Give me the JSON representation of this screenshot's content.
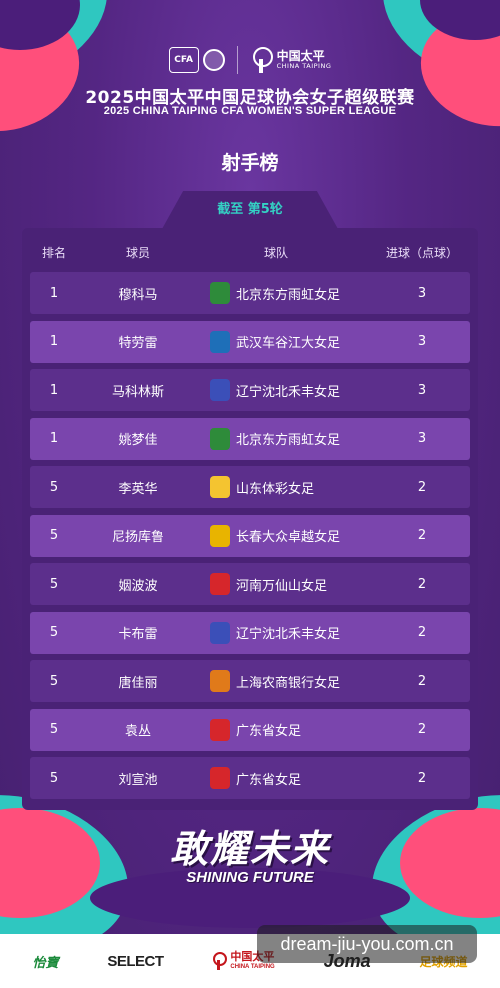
{
  "header": {
    "cfa_badge": "CFA",
    "sponsor_cn": "中国太平",
    "sponsor_en": "CHINA TAIPING",
    "title_cn": "2025中国太平中国足球协会女子超级联赛",
    "title_en": "2025 CHINA TAIPING CFA WOMEN'S SUPER LEAGUE",
    "subtitle": "射手榜"
  },
  "tab": {
    "label": "截至 第5轮"
  },
  "columns": {
    "rank": "排名",
    "player": "球员",
    "team": "球队",
    "goals": "进球（点球）"
  },
  "rows": [
    {
      "rank": "1",
      "player": "穆科马",
      "team": "北京东方雨虹女足",
      "goals": "3",
      "team_color": "#2e8b3a"
    },
    {
      "rank": "1",
      "player": "特劳雷",
      "team": "武汉车谷江大女足",
      "goals": "3",
      "team_color": "#1e6fb8"
    },
    {
      "rank": "1",
      "player": "马科林斯",
      "team": "辽宁沈北禾丰女足",
      "goals": "3",
      "team_color": "#3b4fb8"
    },
    {
      "rank": "1",
      "player": "姚梦佳",
      "team": "北京东方雨虹女足",
      "goals": "3",
      "team_color": "#2e8b3a"
    },
    {
      "rank": "5",
      "player": "李英华",
      "team": "山东体彩女足",
      "goals": "2",
      "team_color": "#f4c430"
    },
    {
      "rank": "5",
      "player": "尼扬库鲁",
      "team": "长春大众卓越女足",
      "goals": "2",
      "team_color": "#e8b400"
    },
    {
      "rank": "5",
      "player": "姻波波",
      "team": "河南万仙山女足",
      "goals": "2",
      "team_color": "#d6262b"
    },
    {
      "rank": "5",
      "player": "卡布雷",
      "team": "辽宁沈北禾丰女足",
      "goals": "2",
      "team_color": "#3b4fb8"
    },
    {
      "rank": "5",
      "player": "唐佳丽",
      "team": "上海农商银行女足",
      "goals": "2",
      "team_color": "#e07a1a"
    },
    {
      "rank": "5",
      "player": "袁丛",
      "team": "广东省女足",
      "goals": "2",
      "team_color": "#d6262b"
    },
    {
      "rank": "5",
      "player": "刘宣池",
      "team": "广东省女足",
      "goals": "2",
      "team_color": "#d6262b"
    }
  ],
  "slogan": {
    "cn": "敢耀未来",
    "en": "SHINING FUTURE"
  },
  "sponsors": {
    "yibao": "怡寶",
    "select": "SELECT",
    "ct_cn": "中国太平",
    "ct_en": "CHINA TAIPING",
    "joma": "Joma",
    "zuqiu": "足球频道"
  },
  "watermark": "dream-jiu-you.com.cn",
  "colors": {
    "background": "#5a2a86",
    "card": "#4a2276",
    "accent_teal": "#34d1c4",
    "accent_pink": "#ff4f7b"
  }
}
